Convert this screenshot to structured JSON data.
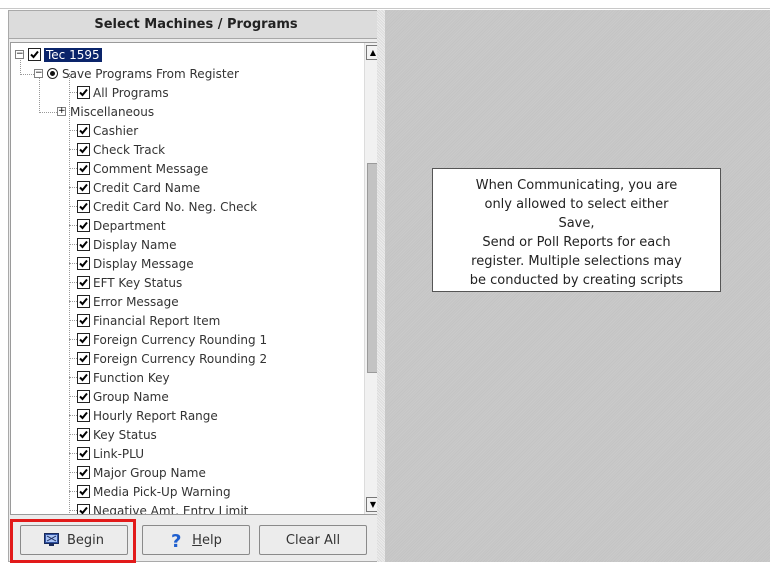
{
  "panel": {
    "title": "Select Machines / Programs"
  },
  "tree": {
    "root": {
      "label": "Tec 1595"
    },
    "save": {
      "label": "Save Programs From Register"
    },
    "all_programs": {
      "label": "All Programs"
    },
    "misc": {
      "label": "Miscellaneous"
    },
    "items": [
      "Cashier",
      "Check Track",
      "Comment Message",
      "Credit Card Name",
      "Credit Card No. Neg. Check",
      "Department",
      "Display Name",
      "Display Message",
      "EFT Key Status",
      "Error Message",
      "Financial Report Item",
      "Foreign Currency Rounding 1",
      "Foreign Currency Rounding 2",
      "Function Key",
      "Group Name",
      "Hourly Report Range",
      "Key Status",
      "Link-PLU",
      "Major Group Name",
      "Media Pick-Up Warning",
      "Negative Amt. Entry Limit"
    ]
  },
  "buttons": {
    "begin": "Begin",
    "help": "Help",
    "clear_all": "Clear All"
  },
  "info": {
    "lines": [
      "When Communicating, you are",
      "only allowed to select either",
      "Save,",
      "Send or Poll Reports for each",
      "register. Multiple selections may",
      "be conducted by creating scripts"
    ]
  },
  "colors": {
    "highlight": "#e21a1a",
    "selection": "#0a246a"
  },
  "icons": {
    "begin": "computer-monitor-icon",
    "help": "question-mark-icon"
  }
}
